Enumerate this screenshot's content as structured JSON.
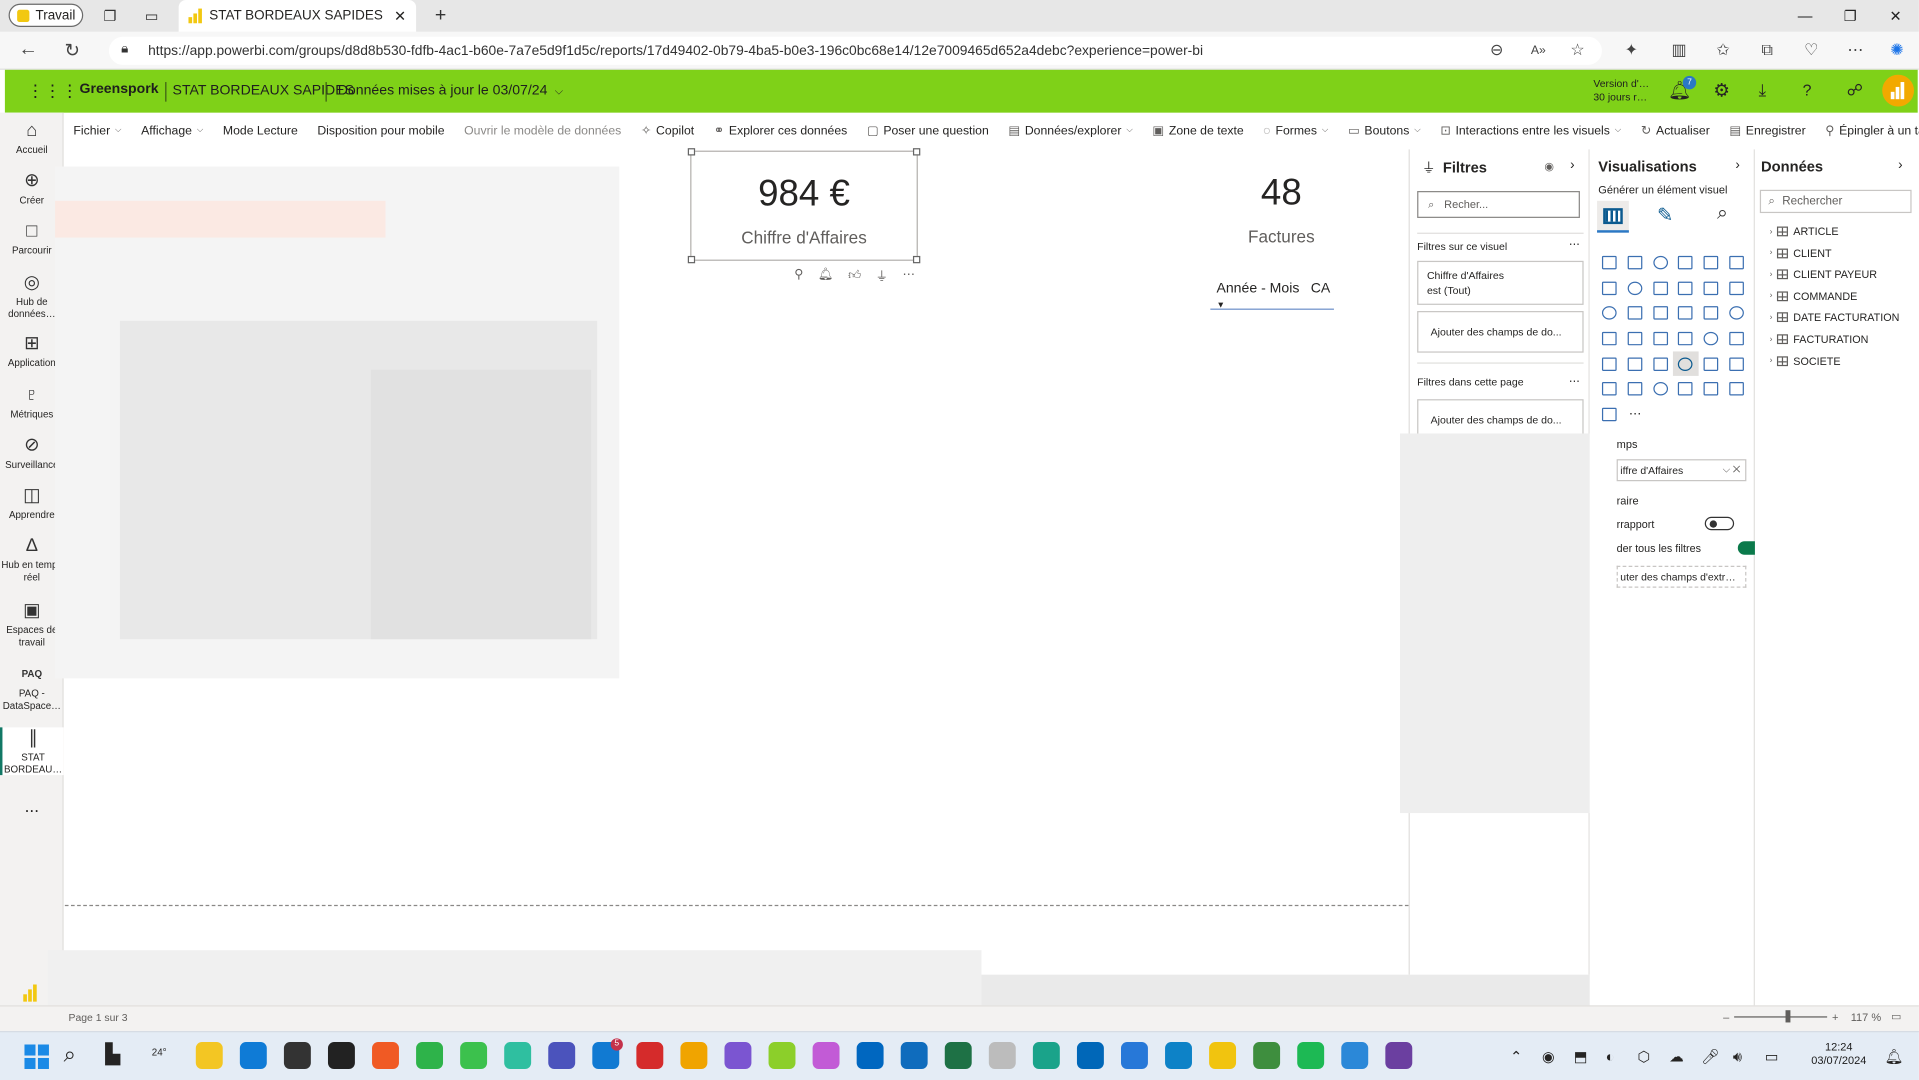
{
  "browser": {
    "profile": "Travail",
    "tab_title": "STAT BORDEAUX SAPIDES - Pow…",
    "url": "https://app.powerbi.com/groups/d8d8b530-fdfb-4ac1-b60e-7a7e5d9f1d5c/reports/17d49402-0b79-4ba5-b0e3-196c0bc68e14/12e7009465d652a4debc?experience=power-bi"
  },
  "header": {
    "org": "Greenspork",
    "report": "STAT BORDEAUX SAPIDES",
    "updated": "Données mises à jour le 03/07/24",
    "version_line1": "Version d'…",
    "version_line2": "30 jours r…",
    "notif_count": "7",
    "accent": "#7fd118"
  },
  "ribbon": [
    {
      "label": "Fichier",
      "dropdown": true
    },
    {
      "label": "Affichage",
      "dropdown": true
    },
    {
      "label": "Mode Lecture"
    },
    {
      "label": "Disposition pour mobile"
    },
    {
      "label": "Ouvrir le modèle de données",
      "disabled": true
    },
    {
      "label": "Copilot",
      "icon": "copilot-icon"
    },
    {
      "label": "Explorer ces données",
      "icon": "binoculars-icon"
    },
    {
      "label": "Poser une question",
      "icon": "chat-icon"
    },
    {
      "label": "Données/explorer",
      "icon": "data-icon",
      "dropdown": true
    },
    {
      "label": "Zone de texte",
      "icon": "textbox-icon"
    },
    {
      "label": "Formes",
      "icon": "shapes-icon",
      "dropdown": true
    },
    {
      "label": "Boutons",
      "icon": "button-icon",
      "dropdown": true
    },
    {
      "label": "Interactions entre les visuels",
      "icon": "interactions-icon",
      "dropdown": true
    },
    {
      "label": "Actualiser",
      "icon": "refresh-icon"
    },
    {
      "label": "Enregistrer",
      "icon": "save-icon"
    },
    {
      "label": "Épingler à un tableau de bord",
      "icon": "pin-icon"
    }
  ],
  "nav": [
    {
      "label": "Accueil",
      "icon": "⌂"
    },
    {
      "label": "Créer",
      "icon": "⊕"
    },
    {
      "label": "Parcourir",
      "icon": "□"
    },
    {
      "label": "Hub de données…",
      "icon": "◎"
    },
    {
      "label": "Application",
      "icon": "⊞"
    },
    {
      "label": "Métriques",
      "icon": "♇"
    },
    {
      "label": "Surveillance",
      "icon": "⊘"
    },
    {
      "label": "Apprendre",
      "icon": "◫"
    },
    {
      "label": "Hub en temps réel",
      "icon": "∆"
    },
    {
      "label": "Espaces de travail",
      "icon": "▣"
    },
    {
      "label": "PAQ - DataSpace…",
      "icon": "PAQ"
    },
    {
      "label": "STAT BORDEAU…",
      "icon": "∥"
    }
  ],
  "nav_more": "...",
  "nav_bottom": "Power B",
  "cards": [
    {
      "value": "984 €",
      "label": "Chiffre d'Affaires"
    },
    {
      "value": "48",
      "label": "Factures"
    }
  ],
  "slicer": {
    "field1": "Année - Mois",
    "field2": "CA"
  },
  "filters": {
    "title": "Filtres",
    "search_placeholder": "Recher...",
    "section_visual": "Filtres sur ce visuel",
    "card_field": "Chiffre d'Affaires",
    "card_cond": "est (Tout)",
    "add_fields": "Ajouter des champs de do...",
    "section_page": "Filtres dans cette page",
    "add_fields_page": "Ajouter des champs de do..."
  },
  "visualizations": {
    "title": "Visualisations",
    "subtitle": "Générer un élément visuel",
    "fields_label": "mps",
    "field_value": "iffre d'Affaires",
    "drill_label": "raire",
    "cross_report": "rrapport",
    "keep_filters": "der tous les filtres",
    "add_drill": "uter des champs d'extr…"
  },
  "data_pane": {
    "title": "Données",
    "search_placeholder": "Rechercher",
    "tables": [
      "ARTICLE",
      "CLIENT",
      "CLIENT PAYEUR",
      "COMMANDE",
      "DATE FACTURATION",
      "FACTURATION",
      "SOCIETE"
    ]
  },
  "status": {
    "page": "Page 1 sur 3",
    "zoom": "117 %"
  },
  "taskbar": {
    "weather": "24°",
    "time": "12:24",
    "date": "03/07/2024",
    "teams_badge": "5"
  }
}
